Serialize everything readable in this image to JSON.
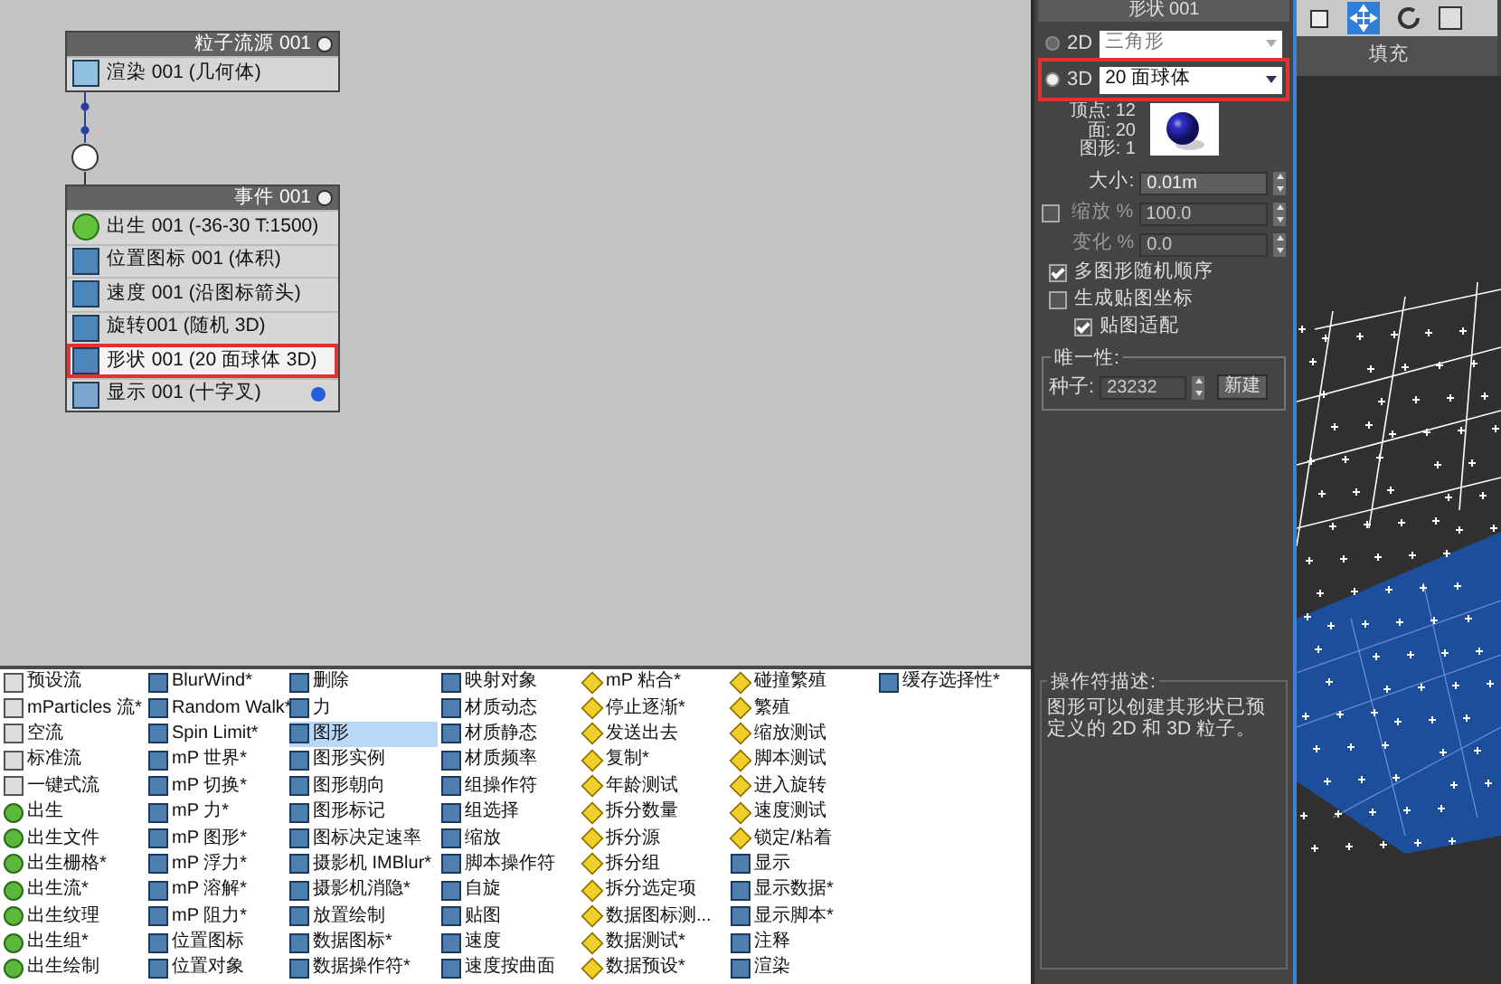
{
  "source_node": {
    "title": "粒子流源 001",
    "rows": [
      {
        "label": "渲染 001 (几何体)",
        "kind": "render"
      }
    ]
  },
  "event_node": {
    "title": "事件 001",
    "rows": [
      {
        "label": "出生 001 (-36-30 T:1500)",
        "kind": "birth",
        "selected": false,
        "dot": false
      },
      {
        "label": "位置图标 001 (体积)",
        "kind": "position",
        "selected": false,
        "dot": false
      },
      {
        "label": "速度 001 (沿图标箭头)",
        "kind": "speed",
        "selected": false,
        "dot": false
      },
      {
        "label": "旋转001 (随机 3D)",
        "kind": "spin",
        "selected": false,
        "dot": false
      },
      {
        "label": "形状 001 (20 面球体 3D)",
        "kind": "shape",
        "selected": true,
        "dot": false
      },
      {
        "label": "显示 001 (十字叉)",
        "kind": "display",
        "selected": false,
        "dot": true
      }
    ]
  },
  "depot": {
    "columns": [
      {
        "items": [
          {
            "label": "预设流",
            "kind": "flow",
            "selected": false
          },
          {
            "label": "mParticles 流*",
            "kind": "flow",
            "selected": false
          },
          {
            "label": "空流",
            "kind": "flow",
            "selected": false
          },
          {
            "label": "标准流",
            "kind": "flow",
            "selected": false
          },
          {
            "label": "一键式流",
            "kind": "flow",
            "selected": false
          },
          {
            "label": "出生",
            "kind": "birth",
            "selected": false
          },
          {
            "label": "出生文件",
            "kind": "birth",
            "selected": false
          },
          {
            "label": "出生栅格*",
            "kind": "birth",
            "selected": false
          },
          {
            "label": "出生流*",
            "kind": "birth",
            "selected": false
          },
          {
            "label": "出生纹理",
            "kind": "birth",
            "selected": false
          },
          {
            "label": "出生组*",
            "kind": "birth",
            "selected": false
          },
          {
            "label": "出生绘制",
            "kind": "birth",
            "selected": false
          }
        ]
      },
      {
        "items": [
          {
            "label": "BlurWind*",
            "kind": "operator",
            "selected": false
          },
          {
            "label": "Random Walk*",
            "kind": "operator",
            "selected": false
          },
          {
            "label": "Spin Limit*",
            "kind": "operator",
            "selected": false
          },
          {
            "label": "mP 世界*",
            "kind": "operator",
            "selected": false
          },
          {
            "label": "mP 切换*",
            "kind": "operator",
            "selected": false
          },
          {
            "label": "mP 力*",
            "kind": "operator",
            "selected": false
          },
          {
            "label": "mP 图形*",
            "kind": "operator",
            "selected": false
          },
          {
            "label": "mP 浮力*",
            "kind": "operator",
            "selected": false
          },
          {
            "label": "mP 溶解*",
            "kind": "operator",
            "selected": false
          },
          {
            "label": "mP 阻力*",
            "kind": "operator",
            "selected": false
          },
          {
            "label": "位置图标",
            "kind": "operator",
            "selected": false
          },
          {
            "label": "位置对象",
            "kind": "operator",
            "selected": false
          }
        ]
      },
      {
        "items": [
          {
            "label": "删除",
            "kind": "operator",
            "selected": false
          },
          {
            "label": "力",
            "kind": "operator",
            "selected": false
          },
          {
            "label": "图形",
            "kind": "operator",
            "selected": true
          },
          {
            "label": "图形实例",
            "kind": "operator",
            "selected": false
          },
          {
            "label": "图形朝向",
            "kind": "operator",
            "selected": false
          },
          {
            "label": "图形标记",
            "kind": "operator",
            "selected": false
          },
          {
            "label": "图标决定速率",
            "kind": "operator",
            "selected": false
          },
          {
            "label": "摄影机 IMBlur*",
            "kind": "operator",
            "selected": false
          },
          {
            "label": "摄影机消隐*",
            "kind": "operator",
            "selected": false
          },
          {
            "label": "放置绘制",
            "kind": "operator",
            "selected": false
          },
          {
            "label": "数据图标*",
            "kind": "operator",
            "selected": false
          },
          {
            "label": "数据操作符*",
            "kind": "operator",
            "selected": false
          }
        ]
      },
      {
        "items": [
          {
            "label": "映射对象",
            "kind": "operator",
            "selected": false
          },
          {
            "label": "材质动态",
            "kind": "operator",
            "selected": false
          },
          {
            "label": "材质静态",
            "kind": "operator",
            "selected": false
          },
          {
            "label": "材质频率",
            "kind": "operator",
            "selected": false
          },
          {
            "label": "组操作符",
            "kind": "operator",
            "selected": false
          },
          {
            "label": "组选择",
            "kind": "operator",
            "selected": false
          },
          {
            "label": "缩放",
            "kind": "operator",
            "selected": false
          },
          {
            "label": "脚本操作符",
            "kind": "operator",
            "selected": false
          },
          {
            "label": "自旋",
            "kind": "operator",
            "selected": false
          },
          {
            "label": "贴图",
            "kind": "operator",
            "selected": false
          },
          {
            "label": "速度",
            "kind": "operator",
            "selected": false
          },
          {
            "label": "速度按曲面",
            "kind": "operator",
            "selected": false
          }
        ]
      },
      {
        "items": [
          {
            "label": "mP 粘合*",
            "kind": "test",
            "selected": false
          },
          {
            "label": "停止逐渐*",
            "kind": "test",
            "selected": false
          },
          {
            "label": "发送出去",
            "kind": "test",
            "selected": false
          },
          {
            "label": "复制*",
            "kind": "test",
            "selected": false
          },
          {
            "label": "年龄测试",
            "kind": "test",
            "selected": false
          },
          {
            "label": "拆分数量",
            "kind": "test",
            "selected": false
          },
          {
            "label": "拆分源",
            "kind": "test",
            "selected": false
          },
          {
            "label": "拆分组",
            "kind": "test",
            "selected": false
          },
          {
            "label": "拆分选定项",
            "kind": "test",
            "selected": false
          },
          {
            "label": "数据图标测...",
            "kind": "test",
            "selected": false
          },
          {
            "label": "数据测试*",
            "kind": "test",
            "selected": false
          },
          {
            "label": "数据预设*",
            "kind": "test",
            "selected": false
          }
        ]
      },
      {
        "items": [
          {
            "label": "碰撞繁殖",
            "kind": "test",
            "selected": false
          },
          {
            "label": "繁殖",
            "kind": "test",
            "selected": false
          },
          {
            "label": "缩放测试",
            "kind": "test",
            "selected": false
          },
          {
            "label": "脚本测试",
            "kind": "test",
            "selected": false
          },
          {
            "label": "进入旋转",
            "kind": "test",
            "selected": false
          },
          {
            "label": "速度测试",
            "kind": "test",
            "selected": false
          },
          {
            "label": "锁定/粘着",
            "kind": "test",
            "selected": false
          },
          {
            "label": "显示",
            "kind": "operator",
            "selected": false
          },
          {
            "label": "显示数据*",
            "kind": "operator",
            "selected": false
          },
          {
            "label": "显示脚本*",
            "kind": "operator",
            "selected": false
          },
          {
            "label": "注释",
            "kind": "operator",
            "selected": false
          },
          {
            "label": "渲染",
            "kind": "operator",
            "selected": false
          }
        ]
      },
      {
        "items": [
          {
            "label": "缓存选择性*",
            "kind": "operator",
            "selected": false
          }
        ]
      }
    ]
  },
  "properties": {
    "rollout_title": "形状 001",
    "shape_2d": {
      "label": "2D",
      "selected": false,
      "value": "三角形",
      "disabled": true,
      "highlighted": false
    },
    "shape_3d": {
      "label": "3D",
      "selected": true,
      "value": "20 面球体",
      "disabled": false,
      "highlighted": true
    },
    "stats": [
      {
        "label": "顶点:",
        "value": "12"
      },
      {
        "label": "面:",
        "value": "20"
      },
      {
        "label": "图形:",
        "value": "1"
      }
    ],
    "size": {
      "label": "大小:",
      "value": "0.01m",
      "disabled": false
    },
    "scale": {
      "label": "缩放 %",
      "checked": false,
      "value": "100.0",
      "disabled": true
    },
    "variation": {
      "label": "变化 %",
      "value": "0.0",
      "disabled": true
    },
    "options": [
      {
        "label": "多图形随机顺序",
        "checked": true
      },
      {
        "label": "生成贴图坐标",
        "checked": false,
        "children": [
          {
            "label": "贴图适配",
            "checked": true
          }
        ]
      }
    ],
    "uniqueness": {
      "title": "唯一性:",
      "seed_label": "种子:",
      "seed": "23232",
      "new_button": "新建"
    }
  },
  "description": {
    "title": "操作符描述:",
    "text": "图形可以创建其形状已预定义的 2D 和 3D 粒子。"
  },
  "viewport": {
    "tab": "填充"
  }
}
